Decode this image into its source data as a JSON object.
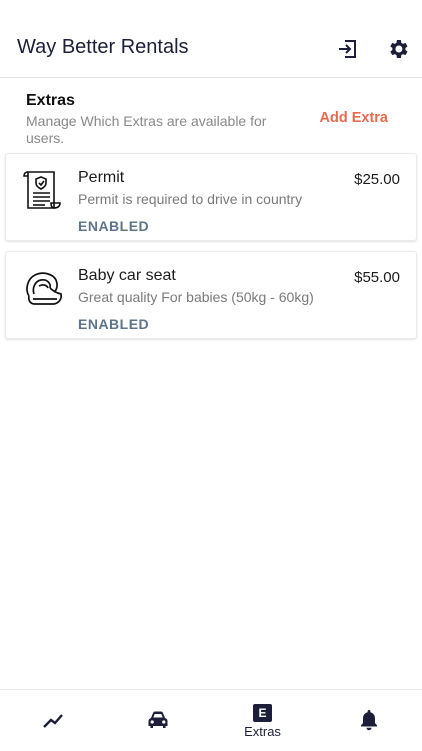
{
  "header": {
    "title": "Way Better Rentals",
    "icons": [
      "logout-icon",
      "gear-icon"
    ]
  },
  "section": {
    "title": "Extras",
    "subtitle": "Manage Which Extras are available for users.",
    "add_label": "Add Extra"
  },
  "extras": [
    {
      "name": "Permit",
      "description": "Permit is required to drive in country",
      "status": "ENABLED",
      "price": "$25.00",
      "icon": "permit-document-icon"
    },
    {
      "name": "Baby car seat",
      "description": "Great quality For babies (50kg - 60kg)",
      "status": "ENABLED",
      "price": "$55.00",
      "icon": "baby-car-seat-icon"
    }
  ],
  "nav": {
    "items": [
      {
        "icon": "chart-icon",
        "label": ""
      },
      {
        "icon": "car-icon",
        "label": ""
      },
      {
        "icon": "extras-icon",
        "badge": "E",
        "label": "Extras"
      },
      {
        "icon": "bell-icon",
        "label": ""
      }
    ]
  },
  "colors": {
    "primary": "#1d1f3a",
    "accent": "#e96b4e",
    "status": "#5e7488"
  }
}
